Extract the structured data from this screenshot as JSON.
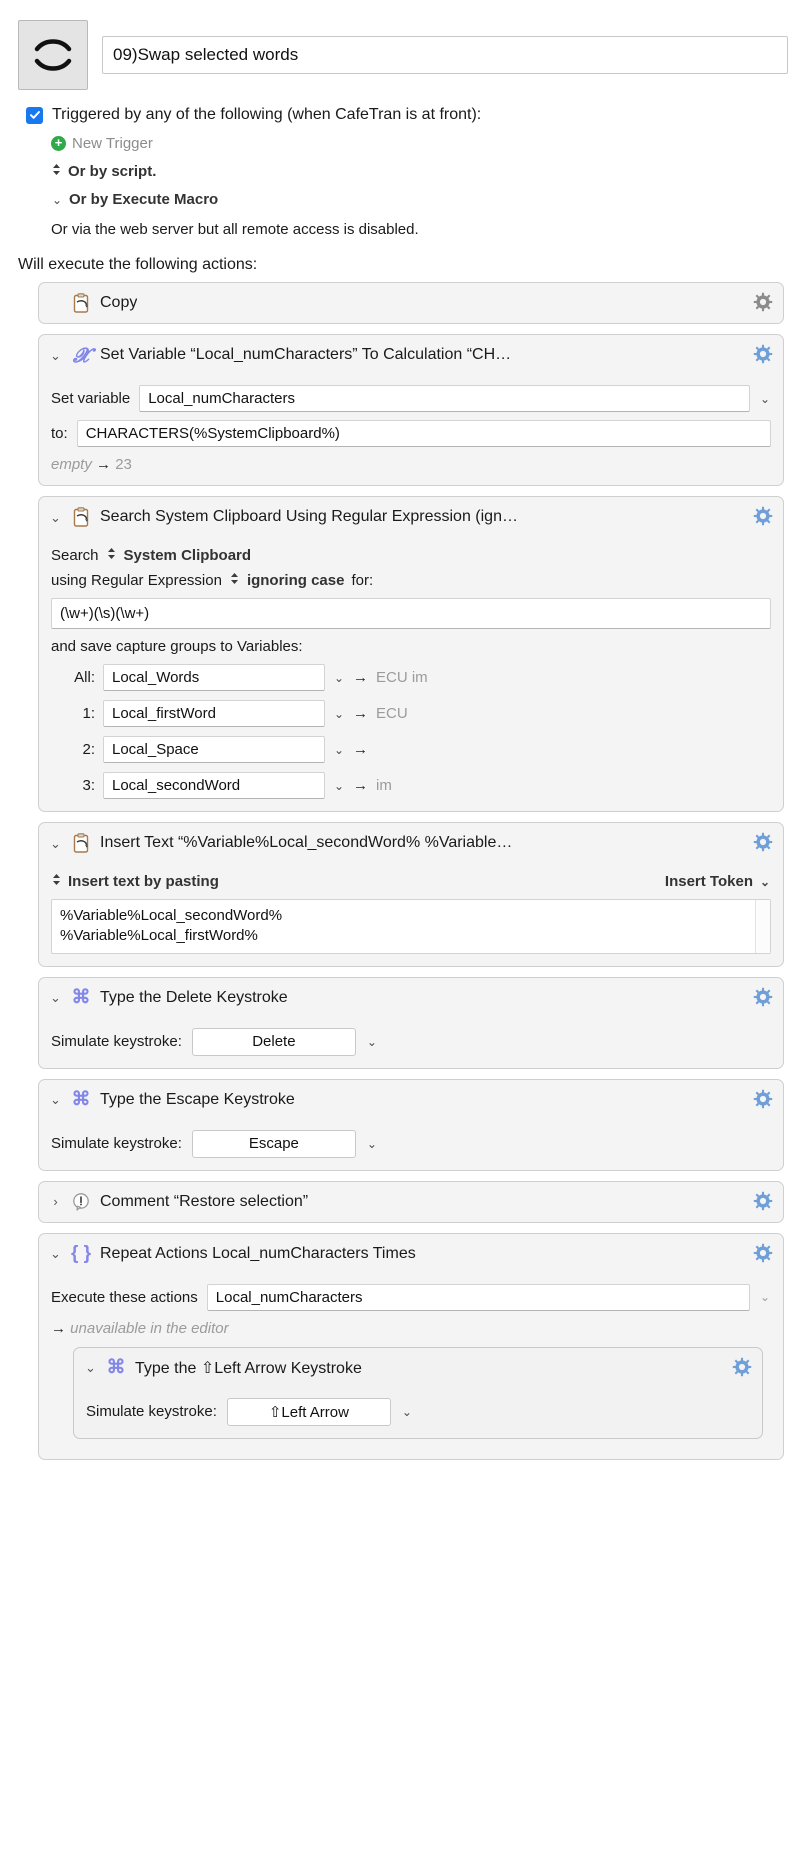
{
  "macro": {
    "icon_name": "swap-arcs-icon",
    "name_value": "09)Swap selected words"
  },
  "triggers": {
    "checkbox_checked": true,
    "main_label": "Triggered by any of the following (when CafeTran is at front):",
    "new_trigger_label": "New Trigger",
    "script_label": "Or by script.",
    "execute_macro_label": "Or by Execute Macro",
    "web_server_label": "Or via the web server but all remote access is disabled."
  },
  "actions_header": "Will execute the following actions:",
  "accent_color": "#8287e8",
  "actions": [
    {
      "id": "copy",
      "icon": "clipboard-copy-icon",
      "title": "Copy",
      "disclosure": "none",
      "gear": true
    },
    {
      "id": "set-variable",
      "icon": "x-variable-icon",
      "title": "Set Variable “Local_numCharacters” To Calculation “CH…",
      "disclosure": "expanded",
      "gear": true,
      "set_variable_label": "Set variable",
      "variable_value": "Local_numCharacters",
      "to_label": "to:",
      "calculation_value": "CHARACTERS(%SystemClipboard%)",
      "result_from": "empty",
      "result_arrow": "→",
      "result_to": "23"
    },
    {
      "id": "search-clipboard",
      "icon": "clipboard-search-icon",
      "title": "Search System Clipboard Using Regular Expression (ign…",
      "disclosure": "expanded",
      "gear": true,
      "search_label": "Search",
      "search_source": "System Clipboard",
      "using_label": "using Regular Expression",
      "case_option": "ignoring case",
      "for_label": "for:",
      "regex_value": "(\\w+)(\\s)(\\w+)",
      "capture_header": "and save capture groups to Variables:",
      "capture_groups": [
        {
          "label": "All:",
          "variable": "Local_Words",
          "result": "ECU im"
        },
        {
          "label": "1:",
          "variable": "Local_firstWord",
          "result": "ECU"
        },
        {
          "label": "2:",
          "variable": "Local_Space",
          "result": ""
        },
        {
          "label": "3:",
          "variable": "Local_secondWord",
          "result": "im"
        }
      ]
    },
    {
      "id": "insert-text",
      "icon": "clipboard-paste-icon",
      "title": "Insert Text “%Variable%Local_secondWord% %Variable…",
      "disclosure": "expanded",
      "gear": true,
      "mode_label": "Insert text by pasting",
      "insert_token_label": "Insert Token",
      "text_line_1": "%Variable%Local_secondWord%",
      "text_line_2": "%Variable%Local_firstWord%"
    },
    {
      "id": "type-delete",
      "icon": "command-key-icon",
      "title": "Type the Delete Keystroke",
      "disclosure": "expanded",
      "gear": true,
      "simulate_label": "Simulate keystroke:",
      "keystroke_value": "Delete"
    },
    {
      "id": "type-escape",
      "icon": "command-key-icon",
      "title": "Type the Escape Keystroke",
      "disclosure": "expanded",
      "gear": true,
      "simulate_label": "Simulate keystroke:",
      "keystroke_value": "Escape"
    },
    {
      "id": "comment",
      "icon": "comment-exclamation-icon",
      "title": "Comment “Restore selection”",
      "disclosure": "collapsed",
      "gear": true
    },
    {
      "id": "repeat-actions",
      "icon": "braces-icon",
      "title": "Repeat Actions Local_numCharacters Times",
      "disclosure": "expanded",
      "gear": true,
      "execute_label": "Execute these actions",
      "count_value": "Local_numCharacters",
      "result_arrow": "→",
      "result_text": "unavailable in the editor",
      "child": {
        "id": "type-left-arrow",
        "icon": "command-key-icon",
        "title": "Type the ⇧Left Arrow Keystroke",
        "disclosure": "expanded",
        "gear": true,
        "simulate_label": "Simulate keystroke:",
        "keystroke_value": "⇧Left Arrow"
      }
    }
  ]
}
